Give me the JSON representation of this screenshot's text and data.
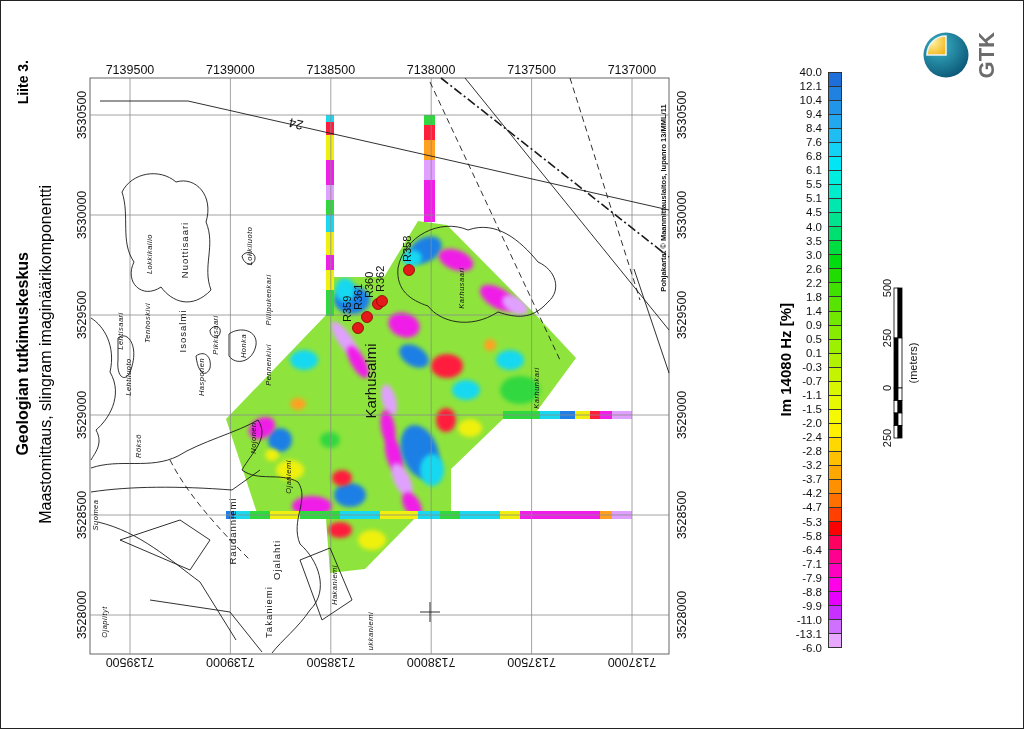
{
  "header": {
    "appendix": "Liite 3.",
    "organization": "Geologian tutkimuskeskus",
    "title": "Maastomittaus, slingram imaginäärikomponentti"
  },
  "map": {
    "top_labels": [
      "7139500",
      "7139000",
      "7138500",
      "7138000",
      "7137500",
      "7137000"
    ],
    "bottom_labels": [
      "7139500",
      "7139000",
      "7138500",
      "7138000",
      "7137500",
      "7137000"
    ],
    "left_labels": [
      "3530500",
      "3530000",
      "3529500",
      "3529000",
      "3528500",
      "3528000"
    ],
    "right_labels": [
      "3530500",
      "3530000",
      "3529500",
      "3529000",
      "3528500",
      "3528000"
    ],
    "road_number": "24",
    "place_names": [
      {
        "name": "Lokkikallio",
        "kind": "minor"
      },
      {
        "name": "Nuottisaari",
        "kind": "major"
      },
      {
        "name": "Lokkiluoto",
        "kind": "minor"
      },
      {
        "name": "Piilipukenkari",
        "kind": "minor"
      },
      {
        "name": "Lehtisaari",
        "kind": "minor"
      },
      {
        "name": "Tenhoskivi",
        "kind": "minor"
      },
      {
        "name": "Isosalmi",
        "kind": "major"
      },
      {
        "name": "Pikkusaari",
        "kind": "minor"
      },
      {
        "name": "Honka",
        "kind": "minor"
      },
      {
        "name": "Lehtiluoto",
        "kind": "minor"
      },
      {
        "name": "Hasponen",
        "kind": "minor"
      },
      {
        "name": "Pennenkivi",
        "kind": "minor"
      },
      {
        "name": "Karhusalmi",
        "kind": "feature"
      },
      {
        "name": "Karhusaari",
        "kind": "minor"
      },
      {
        "name": "Karhunkari",
        "kind": "minor"
      },
      {
        "name": "Röksö",
        "kind": "minor"
      },
      {
        "name": "Nojonen",
        "kind": "minor"
      },
      {
        "name": "Ojaniemi",
        "kind": "minor"
      },
      {
        "name": "Suomea",
        "kind": "minor"
      },
      {
        "name": "Raudanniemi",
        "kind": "major"
      },
      {
        "name": "Ojalahti",
        "kind": "major"
      },
      {
        "name": "Takaniemi",
        "kind": "major"
      },
      {
        "name": "Hakaniemi",
        "kind": "minor"
      },
      {
        "name": "Ojapiityt",
        "kind": "minor"
      },
      {
        "name": "ukkaniemi",
        "kind": "minor"
      }
    ],
    "stations": [
      {
        "label": "R359"
      },
      {
        "label": "R361"
      },
      {
        "label": "R360"
      },
      {
        "label": "R362"
      },
      {
        "label": "R358"
      }
    ],
    "credit": "Pohjakartat © Maanmittauslaitos, lupanro 13/MML/11"
  },
  "color_scale": {
    "title": "Im 14080 Hz [%]",
    "ticks": [
      "40.0",
      "12.1",
      "10.4",
      "9.4",
      "8.4",
      "7.6",
      "6.8",
      "6.1",
      "5.5",
      "5.1",
      "4.5",
      "4.0",
      "3.5",
      "3.0",
      "2.6",
      "2.2",
      "1.8",
      "1.4",
      "0.9",
      "0.5",
      "0.1",
      "-0.3",
      "-0.7",
      "-1.1",
      "-1.5",
      "-2.0",
      "-2.4",
      "-2.8",
      "-3.2",
      "-3.7",
      "-4.2",
      "-4.7",
      "-5.3",
      "-5.8",
      "-6.4",
      "-7.1",
      "-7.9",
      "-8.8",
      "-9.9",
      "-11.0",
      "-13.1",
      "-6.0"
    ],
    "bands": [
      {
        "color": "#1e6fd9"
      },
      {
        "color": "#1f82e0"
      },
      {
        "color": "#2196e8"
      },
      {
        "color": "#22a8ee"
      },
      {
        "color": "#1fbdf2"
      },
      {
        "color": "#12d2f5"
      },
      {
        "color": "#00e6f5"
      },
      {
        "color": "#00eee0"
      },
      {
        "color": "#00eccc"
      },
      {
        "color": "#00e8b0"
      },
      {
        "color": "#00e490"
      },
      {
        "color": "#00e070"
      },
      {
        "color": "#00dd40"
      },
      {
        "color": "#00dc10"
      },
      {
        "color": "#20dc00"
      },
      {
        "color": "#40e000"
      },
      {
        "color": "#58e400"
      },
      {
        "color": "#70e800"
      },
      {
        "color": "#88ec00"
      },
      {
        "color": "#9cf000"
      },
      {
        "color": "#b0f200"
      },
      {
        "color": "#c4f400"
      },
      {
        "color": "#d8f600"
      },
      {
        "color": "#e8f800"
      },
      {
        "color": "#f6fa00"
      },
      {
        "color": "#fff000"
      },
      {
        "color": "#ffd800"
      },
      {
        "color": "#ffc000"
      },
      {
        "color": "#ffa800"
      },
      {
        "color": "#ff9000"
      },
      {
        "color": "#ff7000"
      },
      {
        "color": "#ff4000"
      },
      {
        "color": "#ff0000"
      },
      {
        "color": "#ff0060"
      },
      {
        "color": "#ff0090"
      },
      {
        "color": "#ff00c0"
      },
      {
        "color": "#ff00e8"
      },
      {
        "color": "#e800ff"
      },
      {
        "color": "#c830ff"
      },
      {
        "color": "#d070ff"
      },
      {
        "color": "#e8a8ff"
      }
    ]
  },
  "scale_bar": {
    "ticks": [
      "500",
      "250",
      "0",
      "250"
    ],
    "unit": "(meters)"
  },
  "logo": {
    "text": "GTK"
  }
}
